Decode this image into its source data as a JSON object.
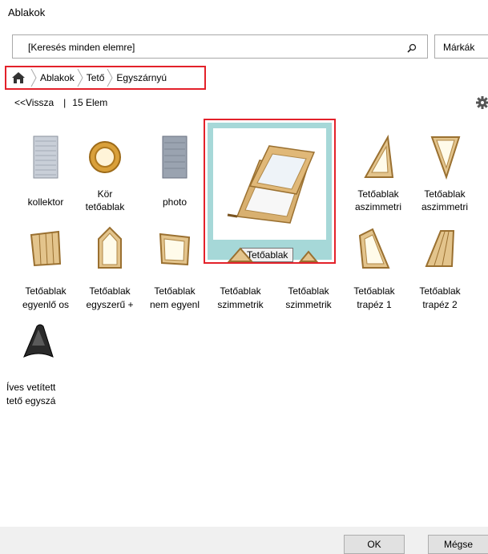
{
  "window": {
    "title": "Ablakok"
  },
  "search": {
    "placeholder": "[Keresés minden elemre]",
    "brand_button": "Márkák"
  },
  "breadcrumb": {
    "items": [
      "Ablakok",
      "Tető",
      "Egyszárnyú"
    ]
  },
  "nav": {
    "back": "<<Vissza",
    "divider": "|",
    "count": "15 Elem"
  },
  "items": [
    {
      "label1": "kollektor",
      "label2": ""
    },
    {
      "label1": "Kör",
      "label2": "tetőablak"
    },
    {
      "label1": "photo",
      "label2": ""
    },
    {
      "label1": "Tetőablak",
      "label2": "",
      "tooltip": "Tetőablak"
    },
    {
      "label1": "Tetőablak",
      "label2": "aszimmetri"
    },
    {
      "label1": "Tetőablak",
      "label2": "aszimmetri"
    },
    {
      "label1": "Tetőablak",
      "label2": "egyenlő os"
    },
    {
      "label1": "Tetőablak",
      "label2": "egyszerű +"
    },
    {
      "label1": "Tetőablak",
      "label2": "nem egyenl"
    },
    {
      "label1": "Tetőablak",
      "label2": "szimmetrik"
    },
    {
      "label1": "Tetőablak",
      "label2": "szimmetrik"
    },
    {
      "label1": "Tetőablak",
      "label2": "trapéz 1"
    },
    {
      "label1": "Tetőablak",
      "label2": "trapéz 2"
    },
    {
      "label1": "Íves vetített",
      "label2": "tető egyszá"
    }
  ],
  "footer": {
    "ok": "OK",
    "cancel": "Mégse"
  },
  "colors": {
    "selection": "#a6d8d8",
    "highlight": "#e3212a",
    "wood": "#d8b070"
  }
}
